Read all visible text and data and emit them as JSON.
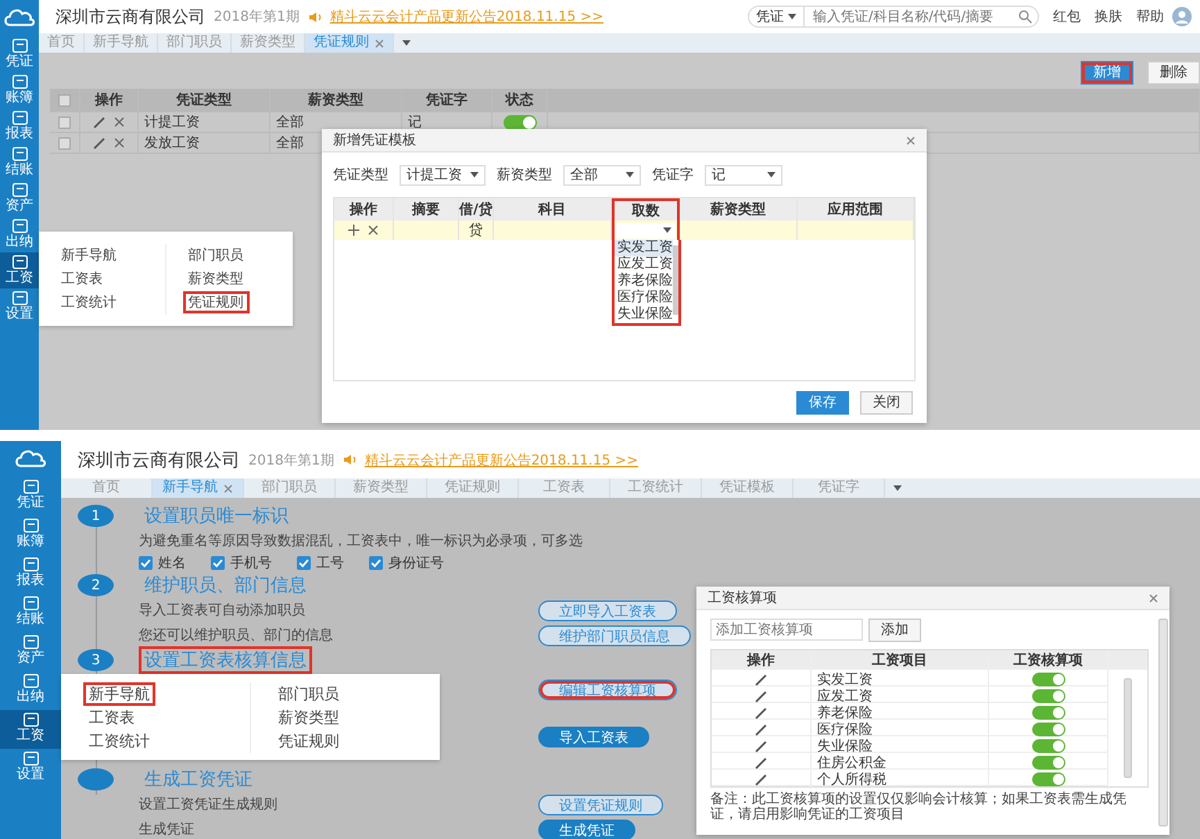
{
  "top_screen": {
    "header": {
      "company": "深圳市云商有限公司",
      "period": "2018年第1期",
      "notice": "精斗云云会计产品更新公告2018.11.15 >>",
      "search": {
        "scope": "凭证",
        "placeholder": "输入凭证/科目名称/代码/摘要"
      },
      "links": [
        "红包",
        "换肤",
        "帮助"
      ]
    },
    "sidebar": [
      {
        "label": "凭证",
        "selected": false
      },
      {
        "label": "账簿",
        "selected": false
      },
      {
        "label": "报表",
        "selected": false
      },
      {
        "label": "结账",
        "selected": false
      },
      {
        "label": "资产",
        "selected": false
      },
      {
        "label": "出纳",
        "selected": false
      },
      {
        "label": "工资",
        "selected": true
      },
      {
        "label": "设置",
        "selected": false
      }
    ],
    "tabs": [
      {
        "label": "首页",
        "selected": false,
        "closable": false
      },
      {
        "label": "新手导航",
        "selected": false,
        "closable": false
      },
      {
        "label": "部门职员",
        "selected": false,
        "closable": false
      },
      {
        "label": "薪资类型",
        "selected": false,
        "closable": false
      },
      {
        "label": "凭证规则",
        "selected": true,
        "closable": true
      }
    ],
    "toolbar": [
      {
        "label": "新增",
        "kind": "primary",
        "highlighted": true
      },
      {
        "label": "删除",
        "kind": "default",
        "highlighted": false
      }
    ],
    "table": {
      "all_checked": false,
      "columns": [
        "操作",
        "凭证类型",
        "薪资类型",
        "凭证字",
        "状态"
      ],
      "rows": [
        {
          "checked": false,
          "cells": [
            "计提工资",
            "全部",
            "记"
          ],
          "enabled": true
        },
        {
          "checked": false,
          "cells": [
            "发放工资",
            "全部"
          ]
        }
      ]
    },
    "nav_menu": [
      {
        "label": "新手导航",
        "highlighted": false
      },
      {
        "label": "部门职员",
        "highlighted": false
      },
      {
        "label": "工资表",
        "highlighted": false
      },
      {
        "label": "薪资类型",
        "highlighted": false
      },
      {
        "label": "工资统计",
        "highlighted": false
      },
      {
        "label": "凭证规则",
        "highlighted": true
      }
    ],
    "dialog": {
      "title": "新增凭证模板",
      "filters": [
        {
          "label": "凭证类型",
          "value": "计提工资"
        },
        {
          "label": "薪资类型",
          "value": "全部"
        },
        {
          "label": "凭证字",
          "value": "记"
        }
      ],
      "columns": [
        {
          "label": "操作",
          "highlighted": false
        },
        {
          "label": "摘要",
          "highlighted": false
        },
        {
          "label": "借/贷",
          "highlighted": false
        },
        {
          "label": "科目",
          "highlighted": false
        },
        {
          "label": "取数",
          "highlighted": true
        },
        {
          "label": "薪资类型",
          "highlighted": false
        },
        {
          "label": "应用范围",
          "highlighted": false
        }
      ],
      "row": {
        "direction": "贷"
      },
      "dropdown": [
        {
          "label": "实发工资",
          "selected": true
        },
        {
          "label": "应发工资",
          "selected": false
        },
        {
          "label": "养老保险",
          "selected": false
        },
        {
          "label": "医疗保险",
          "selected": false
        },
        {
          "label": "失业保险",
          "selected": false
        }
      ],
      "buttons": [
        {
          "label": "保存",
          "kind": "primary"
        },
        {
          "label": "关闭",
          "kind": "default"
        }
      ]
    }
  },
  "bottom_screen": {
    "header": {
      "company": "深圳市云商有限公司",
      "period": "2018年第1期",
      "notice": "精斗云云会计产品更新公告2018.11.15 >>"
    },
    "sidebar": [
      {
        "label": "凭证",
        "selected": false
      },
      {
        "label": "账簿",
        "selected": false
      },
      {
        "label": "报表",
        "selected": false
      },
      {
        "label": "结账",
        "selected": false
      },
      {
        "label": "资产",
        "selected": false
      },
      {
        "label": "出纳",
        "selected": false
      },
      {
        "label": "工资",
        "selected": true
      },
      {
        "label": "设置",
        "selected": false
      }
    ],
    "tabs": [
      {
        "label": "首页",
        "selected": false,
        "closable": false
      },
      {
        "label": "新手导航",
        "selected": true,
        "closable": true
      },
      {
        "label": "部门职员",
        "selected": false,
        "closable": false
      },
      {
        "label": "薪资类型",
        "selected": false,
        "closable": false
      },
      {
        "label": "凭证规则",
        "selected": false,
        "closable": false
      },
      {
        "label": "工资表",
        "selected": false,
        "closable": false
      },
      {
        "label": "工资统计",
        "selected": false,
        "closable": false
      },
      {
        "label": "凭证模板",
        "selected": false,
        "closable": false
      },
      {
        "label": "凭证字",
        "selected": false,
        "closable": false
      }
    ],
    "steps": [
      {
        "number": "1",
        "title": "设置职员唯一标识",
        "highlighted": false,
        "lines": [
          {
            "text": "为避免重名等原因导致数据混乱，工资表中，唯一标识为必录项，可多选"
          }
        ],
        "options": [
          {
            "label": "姓名",
            "checked": true
          },
          {
            "label": "手机号",
            "checked": true
          },
          {
            "label": "工号",
            "checked": true
          },
          {
            "label": "身份证号",
            "checked": true
          }
        ]
      },
      {
        "number": "2",
        "title": "维护职员、部门信息",
        "highlighted": false,
        "lines": [
          {
            "text": "导入工资表可自动添加职员",
            "action": {
              "label": "立即导入工资表",
              "kind": "outline",
              "highlighted": false
            }
          },
          {
            "text": "您还可以维护职员、部门的信息",
            "action": {
              "label": "维护部门职员信息",
              "kind": "outline",
              "highlighted": false
            }
          }
        ]
      },
      {
        "number": "3",
        "title": "设置工资表核算信息",
        "highlighted": true,
        "lines": [
          {
            "action": {
              "label": "编辑工资核算项",
              "kind": "outline",
              "highlighted": true
            }
          },
          {
            "action": {
              "label": "导入工资表",
              "kind": "filled",
              "highlighted": false
            }
          }
        ]
      },
      {
        "title": "生成工资凭证",
        "highlighted": false,
        "lines": [
          {
            "text": "设置工资凭证生成规则",
            "action": {
              "label": "设置凭证规则",
              "kind": "outline",
              "highlighted": false
            }
          },
          {
            "text": "生成凭证",
            "action": {
              "label": "生成凭证",
              "kind": "filled",
              "highlighted": false
            }
          }
        ]
      }
    ],
    "nav_menu": [
      {
        "label": "新手导航",
        "highlighted": true
      },
      {
        "label": "部门职员",
        "highlighted": false
      },
      {
        "label": "工资表",
        "highlighted": false
      },
      {
        "label": "薪资类型",
        "highlighted": false
      },
      {
        "label": "工资统计",
        "highlighted": false
      },
      {
        "label": "凭证规则",
        "highlighted": false
      }
    ],
    "dialog": {
      "title": "工资核算项",
      "placeholder": "添加工资核算项",
      "add_button": "添加",
      "columns": [
        "操作",
        "工资项目",
        "工资核算项"
      ],
      "rows": [
        {
          "item": "实发工资",
          "enabled": true
        },
        {
          "item": "应发工资",
          "enabled": true
        },
        {
          "item": "养老保险",
          "enabled": true
        },
        {
          "item": "医疗保险",
          "enabled": true
        },
        {
          "item": "失业保险",
          "enabled": true
        },
        {
          "item": "住房公积金",
          "enabled": true
        },
        {
          "item": "个人所得税",
          "enabled": true
        }
      ],
      "note": "备注：此工资核算项的设置仅仅影响会计核算；如果工资表需生成凭证，请启用影响凭证的工资项目"
    }
  }
}
